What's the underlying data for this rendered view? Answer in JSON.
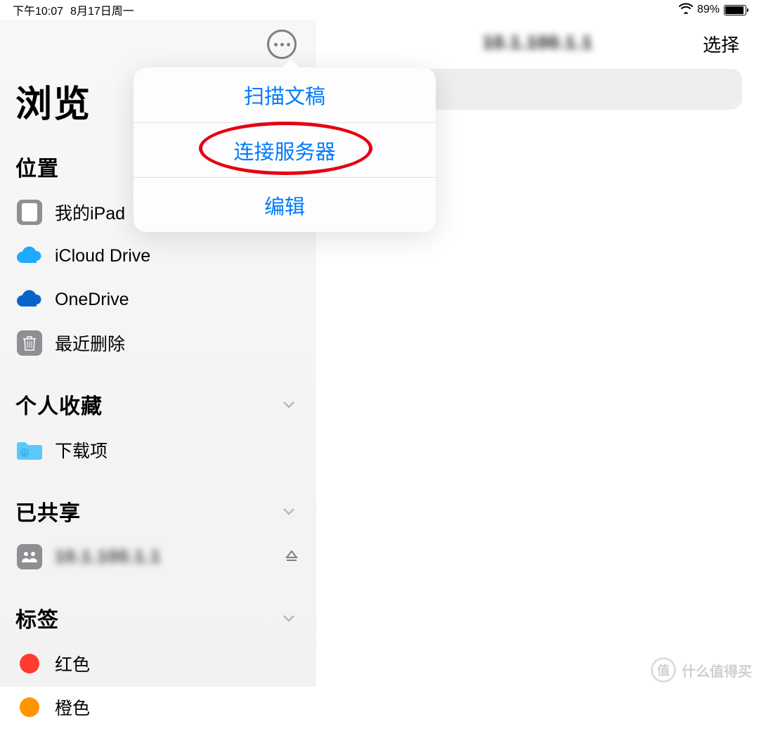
{
  "status": {
    "time": "下午10:07",
    "date": "8月17日周一",
    "battery_pct": "89%"
  },
  "sidebar": {
    "browse_title": "浏览",
    "locations": {
      "header": "位置",
      "items": [
        {
          "label": "我的iPad"
        },
        {
          "label": "iCloud Drive"
        },
        {
          "label": "OneDrive"
        },
        {
          "label": "最近删除"
        }
      ]
    },
    "favorites": {
      "header": "个人收藏",
      "items": [
        {
          "label": "下载项"
        }
      ]
    },
    "shared": {
      "header": "已共享",
      "items": [
        {
          "label_blurred": "10.1.100.1.1"
        }
      ]
    },
    "tags": {
      "header": "标签",
      "items": [
        {
          "label": "红色",
          "color": "#ff3b30"
        },
        {
          "label": "橙色",
          "color": "#ff9500"
        }
      ]
    }
  },
  "content": {
    "title_blurred": "10.1.100.1.1",
    "select_label": "选择"
  },
  "popover": {
    "items": [
      {
        "label": "扫描文稿"
      },
      {
        "label": "连接服务器"
      },
      {
        "label": "编辑"
      }
    ]
  },
  "watermark": {
    "text": "什么值得买",
    "badge": "值"
  }
}
